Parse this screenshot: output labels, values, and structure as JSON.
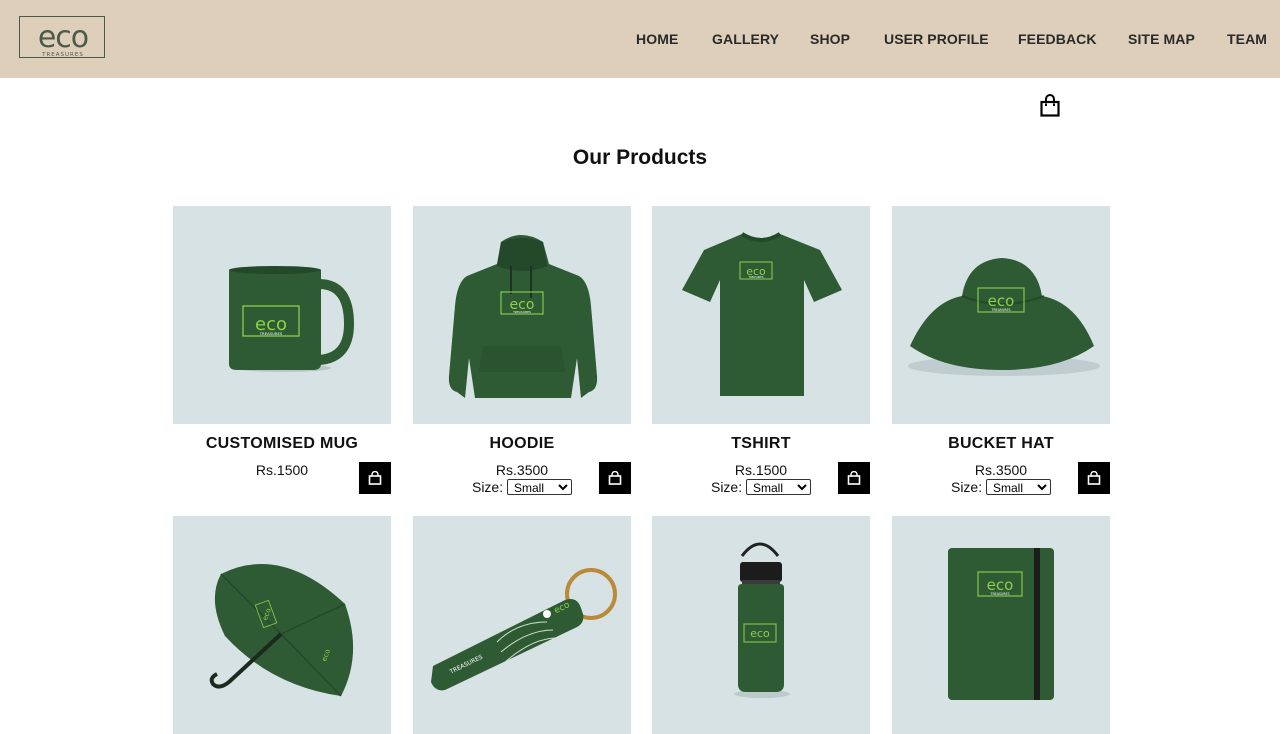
{
  "brand": {
    "logo_word": "eco",
    "logo_sub": "TREASURES"
  },
  "nav": {
    "items": [
      {
        "label": "HOME"
      },
      {
        "label": "GALLERY"
      },
      {
        "label": "SHOP"
      },
      {
        "label": "USER PROFILE"
      },
      {
        "label": "FEEDBACK"
      },
      {
        "label": "SITE MAP"
      },
      {
        "label": "TEAM"
      }
    ]
  },
  "cart_icon": "shopping-bag-icon",
  "main": {
    "title": "Our Products"
  },
  "products": [
    {
      "name": "CUSTOMISED MUG",
      "price": "Rs.1500",
      "image": "mug-image",
      "has_size": false
    },
    {
      "name": "HOODIE",
      "price": "Rs.3500",
      "image": "hoodie-image",
      "has_size": true,
      "size_label": "Size:",
      "size_value": "Small"
    },
    {
      "name": "TSHIRT",
      "price": "Rs.1500",
      "image": "tshirt-image",
      "has_size": true,
      "size_label": "Size:",
      "size_value": "Small"
    },
    {
      "name": "BUCKET HAT",
      "price": "Rs.3500",
      "image": "bucket-hat-image",
      "has_size": true,
      "size_label": "Size:",
      "size_value": "Small"
    },
    {
      "name": "",
      "price": "",
      "image": "umbrella-image"
    },
    {
      "name": "",
      "price": "",
      "image": "keychain-image"
    },
    {
      "name": "",
      "price": "",
      "image": "water-bottle-image"
    },
    {
      "name": "",
      "price": "",
      "image": "notebook-image"
    }
  ],
  "colors": {
    "navbar": "#decfbb",
    "product_bg": "#d7e2e4",
    "product_green": "#2e5a34",
    "logo_green": "#8bd14a"
  }
}
